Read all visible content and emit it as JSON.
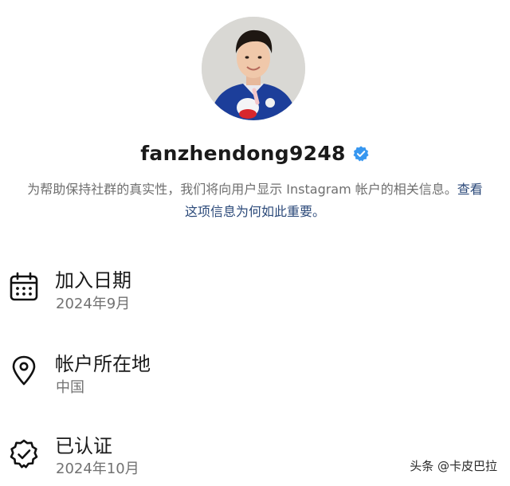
{
  "profile": {
    "username": "fanzhendong9248",
    "verified": true,
    "avatar_icon": "profile-photo",
    "badge_color": "#3797f0"
  },
  "notice": {
    "text": "为帮助保持社群的真实性，我们将向用户显示 Instagram 帐户的相关信息。",
    "link_text": "查看这项信息为何如此重要。",
    "link_color": "#2c4a7a"
  },
  "details": [
    {
      "icon": "calendar-icon",
      "title": "加入日期",
      "value": "2024年9月"
    },
    {
      "icon": "location-pin-icon",
      "title": "帐户所在地",
      "value": "中国"
    },
    {
      "icon": "verified-badge-outline-icon",
      "title": "已认证",
      "value": "2024年10月"
    }
  ],
  "watermark": "头条 @卡皮巴拉"
}
